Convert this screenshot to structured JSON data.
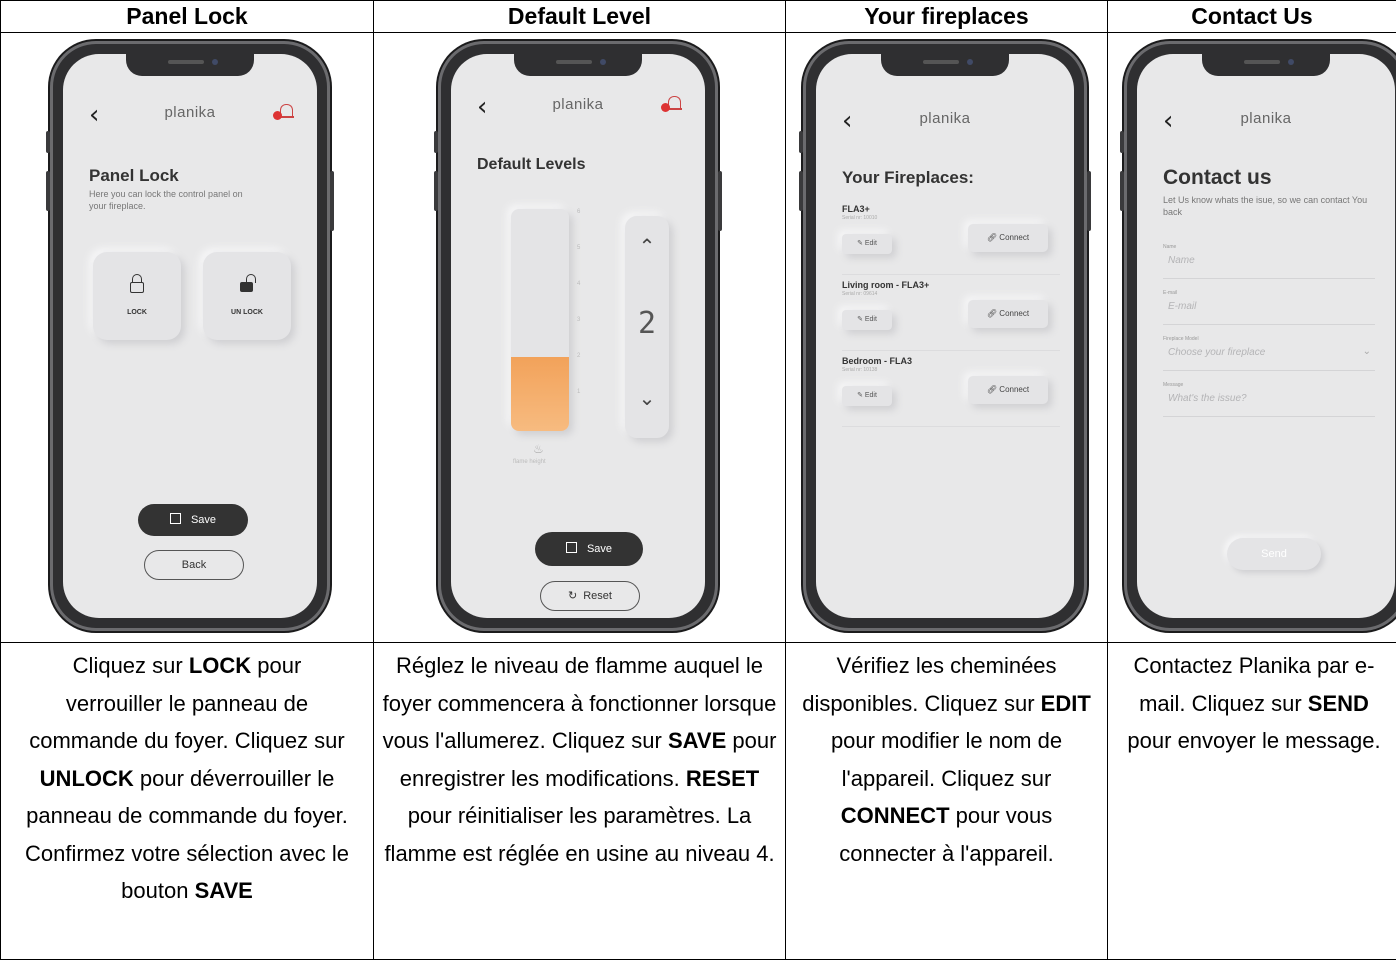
{
  "columns": [
    {
      "header": "Panel Lock"
    },
    {
      "header": "Default Level"
    },
    {
      "header": "Your fireplaces"
    },
    {
      "header": "Contact Us"
    }
  ],
  "phones": {
    "brand": "planika",
    "panel_lock": {
      "title": "Panel Lock",
      "subtitle": "Here you can lock the control panel on your fireplace.",
      "lock_label": "LOCK",
      "unlock_label": "UN LOCK",
      "save_label": "Save",
      "back_label": "Back"
    },
    "default_level": {
      "title": "Default Levels",
      "level_display": "2",
      "ticks": [
        "6",
        "5",
        "4",
        "3",
        "2",
        "1"
      ],
      "flame_caption": "flame height",
      "level_fraction": 0.333,
      "save_label": "Save",
      "reset_label": "Reset"
    },
    "fireplaces": {
      "title": "Your Fireplaces:",
      "items": [
        {
          "name": "FLA3+",
          "serial": "Serial nr: 10010",
          "edit": "Edit",
          "connect": "Connect"
        },
        {
          "name": "Living room - FLA3+",
          "serial": "Serial nr: 09614",
          "edit": "Edit",
          "connect": "Connect"
        },
        {
          "name": "Bedroom - FLA3",
          "serial": "Serial nr: 10138",
          "edit": "Edit",
          "connect": "Connect"
        }
      ]
    },
    "contact": {
      "title": "Contact us",
      "subtitle": "Let Us know whats the isue, so we can contact You back",
      "fields": [
        {
          "label": "Name",
          "placeholder": "Name"
        },
        {
          "label": "E-mail",
          "placeholder": "E-mail"
        },
        {
          "label": "Fireplace Model",
          "placeholder": "Choose your fireplace"
        },
        {
          "label": "Message",
          "placeholder": "What's the issue?"
        }
      ],
      "send_label": "Send"
    }
  },
  "descriptions": {
    "panel_lock": {
      "t1": "Cliquez sur ",
      "b1": "LOCK",
      "t2": " pour verrouiller le panneau de commande du foyer. Cliquez sur ",
      "b2": "UNLOCK",
      "t3": " pour déverrouiller le panneau de commande du foyer. Confirmez votre sélection avec le bouton ",
      "b3": "SAVE"
    },
    "default_level": {
      "t1": "Réglez le niveau de flamme auquel le foyer commencera à fonctionner lorsque vous l'allumerez. Cliquez sur ",
      "b1": "SAVE",
      "t2": " pour enregistrer les modifications. ",
      "b2": "RESET",
      "t3": " pour réinitialiser les paramètres. La flamme est réglée en usine au niveau 4."
    },
    "fireplaces": {
      "t1": "Vérifiez les cheminées disponibles. Cliquez sur ",
      "b1": "EDIT",
      "t2": " pour modifier le nom de l'appareil. Cliquez sur ",
      "b2": "CONNECT",
      "t3": " pour vous connecter à l'appareil."
    },
    "contact": {
      "t1": "Contactez Planika par e-mail. Cliquez sur ",
      "b1": "SEND",
      "t2": " pour envoyer le message."
    }
  }
}
